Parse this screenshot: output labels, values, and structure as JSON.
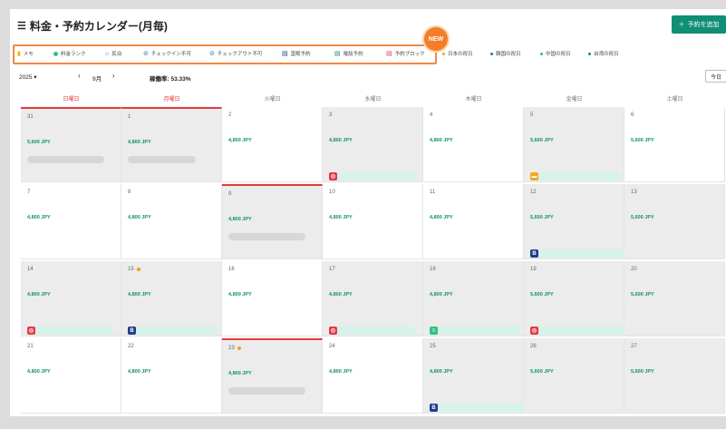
{
  "header": {
    "title": "料金・予約カレンダー(月毎)",
    "add_button": "予約を追加",
    "new_badge": "NEW"
  },
  "legend": [
    {
      "label": "メモ",
      "icon": "memo-icon",
      "color": "#f4b400"
    },
    {
      "label": "料金ランク",
      "icon": "rank-dot-icon",
      "color": "#2ec27e"
    },
    {
      "label": "民泊",
      "icon": "house-icon",
      "color": "#1b75bc"
    },
    {
      "label": "チェックイン不可",
      "icon": "checkin-block-icon",
      "color": "#1b75bc"
    },
    {
      "label": "チェックアウト不可",
      "icon": "checkout-block-icon",
      "color": "#1b75bc"
    },
    {
      "label": "直販予約",
      "icon": "calendar-icon",
      "color": "#1f3d8c"
    },
    {
      "label": "電話予約",
      "icon": "calendar-icon",
      "color": "#0f8f73"
    },
    {
      "label": "予約ブロック",
      "icon": "calendar-icon",
      "color": "#e23a3a"
    },
    {
      "label": "日本の祝日",
      "icon": "dot-icon",
      "color": "#f0a020"
    },
    {
      "label": "韓国の祝日",
      "icon": "dot-icon",
      "color": "#1b75bc"
    },
    {
      "label": "中国の祝日",
      "icon": "dot-icon",
      "color": "#2ec27e"
    },
    {
      "label": "台湾の祝日",
      "icon": "dot-icon",
      "color": "#0f8f73"
    }
  ],
  "controls": {
    "year": "2025 ▾",
    "prev": "‹",
    "month": "9月",
    "next": "›",
    "occupancy_label": "稼働率: 53.33%",
    "today": "今日"
  },
  "weekdays": [
    {
      "label": "日曜日",
      "color": "#e23a3a"
    },
    {
      "label": "月曜日",
      "color": "#e23a3a"
    },
    {
      "label": "火曜日",
      "color": "#777777"
    },
    {
      "label": "水曜日",
      "color": "#777777"
    },
    {
      "label": "木曜日",
      "color": "#777777"
    },
    {
      "label": "金曜日",
      "color": "#777777"
    },
    {
      "label": "土曜日",
      "color": "#777777"
    }
  ],
  "weeks": [
    [
      {
        "day": "31",
        "price": "5,600 JPY",
        "shade": true,
        "today": true,
        "blur": 85
      },
      {
        "day": "1",
        "price": "4,800 JPY",
        "shade": true,
        "today": true,
        "blur": 75
      },
      {
        "day": "2",
        "price": "4,800 JPY",
        "shade": false
      },
      {
        "day": "3",
        "price": "4,800 JPY",
        "shade": true,
        "icon": "red",
        "bar": 90
      },
      {
        "day": "4",
        "price": "4,800 JPY",
        "shade": false
      },
      {
        "day": "5",
        "price": "5,600 JPY",
        "shade": true,
        "icon": "gold",
        "bar": 95
      },
      {
        "day": "6",
        "price": "5,600 JPY",
        "shade": false
      }
    ],
    [
      {
        "day": "7",
        "price": "4,800 JPY",
        "shade": false
      },
      {
        "day": "8",
        "price": "4,800 JPY",
        "shade": false
      },
      {
        "day": "9",
        "price": "4,800 JPY",
        "shade": true,
        "today": true,
        "blur": 85
      },
      {
        "day": "10",
        "price": "4,800 JPY",
        "shade": false
      },
      {
        "day": "11",
        "price": "4,800 JPY",
        "shade": false
      },
      {
        "day": "12",
        "price": "5,600 JPY",
        "shade": true,
        "icon": "blue",
        "bar": 210
      },
      {
        "day": "13",
        "price": "5,600 JPY",
        "shade": true
      }
    ],
    [
      {
        "day": "14",
        "price": "4,800 JPY",
        "shade": true,
        "icon": "red",
        "bar": 90
      },
      {
        "day": "15",
        "price": "4,800 JPY",
        "shade": true,
        "holiday": true,
        "icon": "blue",
        "bar": 95
      },
      {
        "day": "16",
        "price": "4,800 JPY",
        "shade": false
      },
      {
        "day": "17",
        "price": "4,800 JPY",
        "shade": true,
        "icon": "red",
        "bar": 90
      },
      {
        "day": "18",
        "price": "4,800 JPY",
        "shade": true,
        "icon": "grn",
        "bar": 95
      },
      {
        "day": "19",
        "price": "5,600 JPY",
        "shade": true,
        "icon": "red",
        "bar": 210
      },
      {
        "day": "20",
        "price": "5,600 JPY",
        "shade": true
      }
    ],
    [
      {
        "day": "21",
        "price": "4,800 JPY",
        "shade": false
      },
      {
        "day": "22",
        "price": "4,800 JPY",
        "shade": false
      },
      {
        "day": "23",
        "price": "4,800 JPY",
        "shade": true,
        "today": true,
        "holiday": true,
        "blur": 85
      },
      {
        "day": "24",
        "price": "4,800 JPY",
        "shade": false
      },
      {
        "day": "25",
        "price": "4,800 JPY",
        "shade": true,
        "icon": "blue",
        "bar": 320
      },
      {
        "day": "26",
        "price": "5,600 JPY",
        "shade": true
      },
      {
        "day": "27",
        "price": "5,600 JPY",
        "shade": true
      }
    ]
  ]
}
